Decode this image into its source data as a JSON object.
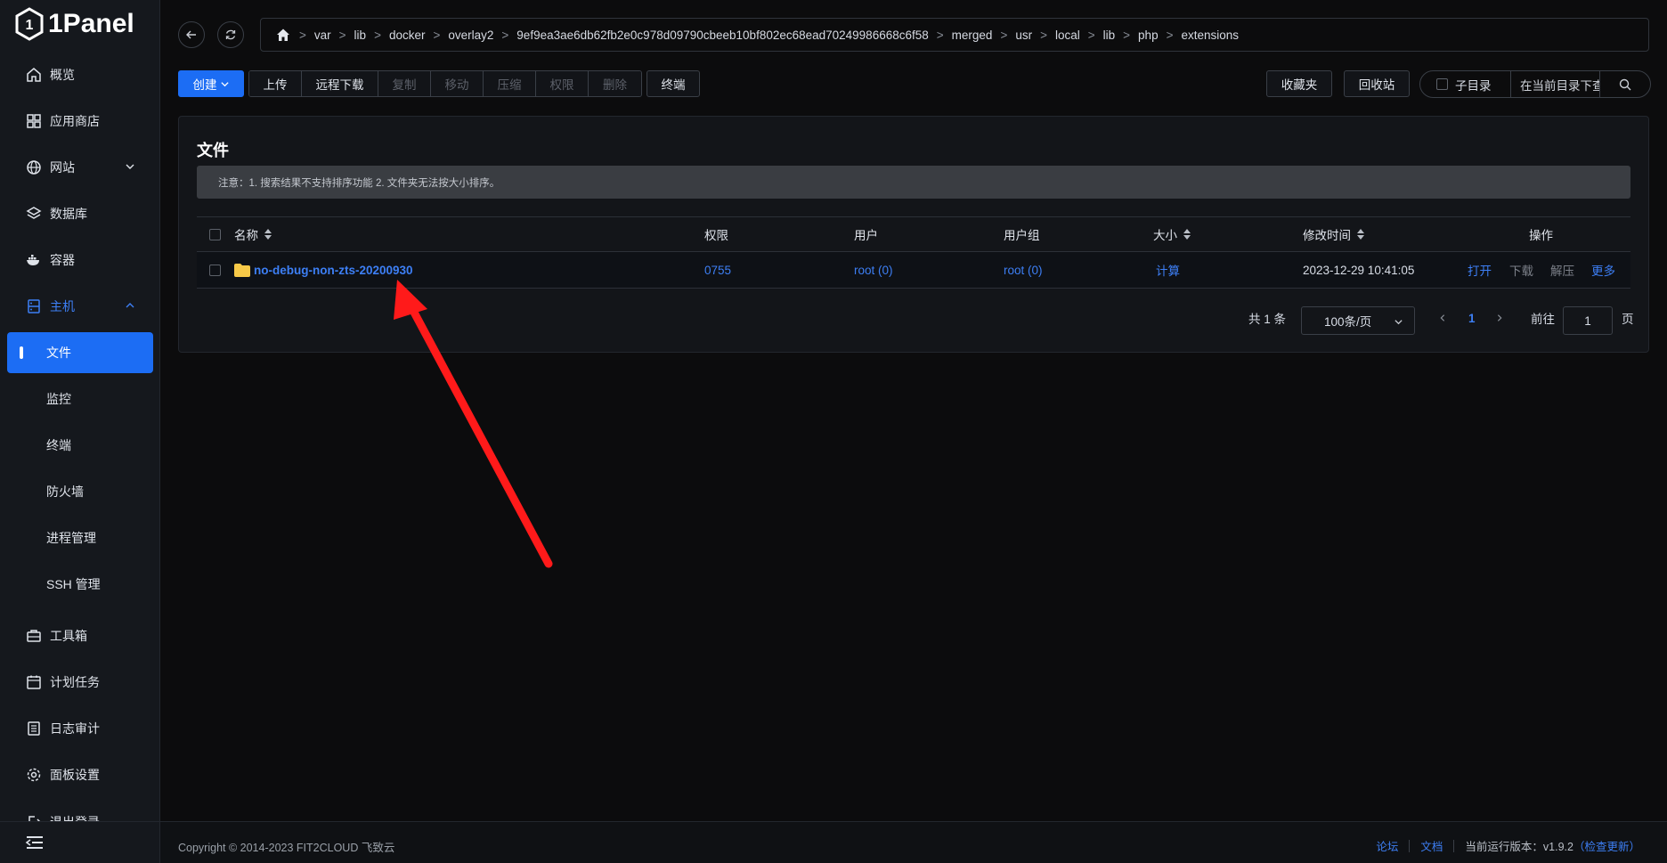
{
  "brand": {
    "name": "1Panel"
  },
  "sidebar": {
    "items": [
      {
        "label": "概览",
        "icon": "home-icon"
      },
      {
        "label": "应用商店",
        "icon": "grid-icon"
      },
      {
        "label": "网站",
        "icon": "globe-icon"
      },
      {
        "label": "数据库",
        "icon": "layers-icon"
      },
      {
        "label": "容器",
        "icon": "docker-icon"
      },
      {
        "label": "主机",
        "icon": "host-icon"
      },
      {
        "label": "工具箱",
        "icon": "toolbox-icon"
      },
      {
        "label": "计划任务",
        "icon": "calendar-icon"
      },
      {
        "label": "日志审计",
        "icon": "log-icon"
      },
      {
        "label": "面板设置",
        "icon": "settings-icon"
      },
      {
        "label": "退出登录",
        "icon": "logout-icon"
      }
    ],
    "host_sub": [
      "文件",
      "监控",
      "终端",
      "防火墙",
      "进程管理",
      "SSH 管理"
    ],
    "active_sub": "文件"
  },
  "breadcrumb": [
    "var",
    "lib",
    "docker",
    "overlay2",
    "9ef9ea3ae6db62fb2e0c978d09790cbeeb10bf802ec68ead70249986668c6f58",
    "merged",
    "usr",
    "local",
    "lib",
    "php",
    "extensions"
  ],
  "toolbar": {
    "create": "创建",
    "group": [
      "上传",
      "远程下载",
      "复制",
      "移动",
      "压缩",
      "权限",
      "删除"
    ],
    "terminal": "终端",
    "favorites": "收藏夹",
    "recycle": "回收站",
    "subdir": "子目录",
    "search_placeholder": "在当前目录下查找"
  },
  "card": {
    "title": "文件",
    "notice": "注意：1. 搜索结果不支持排序功能 2. 文件夹无法按大小排序。"
  },
  "table": {
    "headers": [
      "名称",
      "权限",
      "用户",
      "用户组",
      "大小",
      "修改时间",
      "操作"
    ],
    "rows": [
      {
        "name": "no-debug-non-zts-20200930",
        "perm": "0755",
        "user": "root (0)",
        "group": "root (0)",
        "size": "计算",
        "mtime": "2023-12-29 10:41:05",
        "actions": [
          "打开",
          "下载",
          "解压",
          "更多"
        ]
      }
    ]
  },
  "pagination": {
    "total": "共 1 条",
    "page_size": "100条/页",
    "current": "1",
    "goto_label": "前往",
    "goto_value": "1",
    "page_suffix": "页"
  },
  "footer": {
    "copyright": "Copyright © 2014-2023 FIT2CLOUD 飞致云",
    "forum": "论坛",
    "docs": "文档",
    "version": "当前运行版本：v1.9.2",
    "check_update": "（检查更新）"
  },
  "colors": {
    "accent": "#1c6df4",
    "annotation_arrow": "#ff1a1a",
    "folder": "#f7c948"
  }
}
